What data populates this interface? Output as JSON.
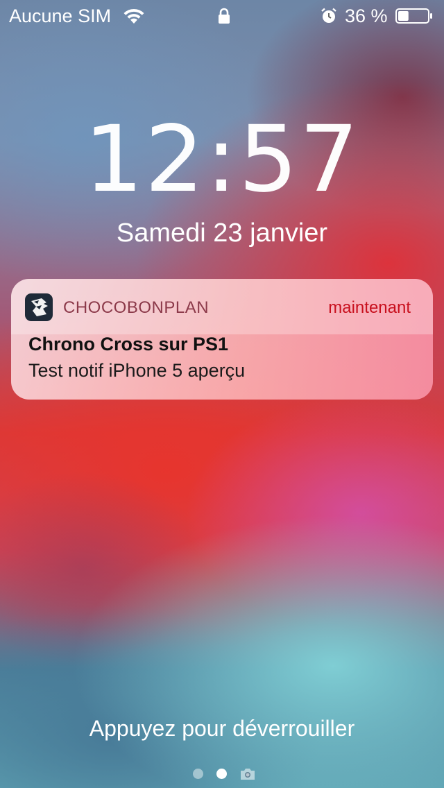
{
  "status_bar": {
    "carrier": "Aucune SIM",
    "battery_percent": "36 %",
    "battery_level": 0.36,
    "icons": [
      "wifi-icon",
      "lock-icon",
      "alarm-icon",
      "battery-icon"
    ]
  },
  "lock_screen": {
    "time": "12:57",
    "date": "Samedi 23 janvier",
    "unlock_hint": "Appuyez pour déverrouiller",
    "pages": {
      "count": 2,
      "current": 2,
      "camera_icon": "camera-icon"
    }
  },
  "notification": {
    "app_name": "CHOCOBONPLAN",
    "app_icon": "chocobonplan-app-icon",
    "time": "maintenant",
    "title": "Chrono Cross sur PS1",
    "body": "Test notif iPhone 5 aperçu"
  },
  "colors": {
    "notification_time": "#c8101e",
    "app_name": "#8c3a4a"
  }
}
